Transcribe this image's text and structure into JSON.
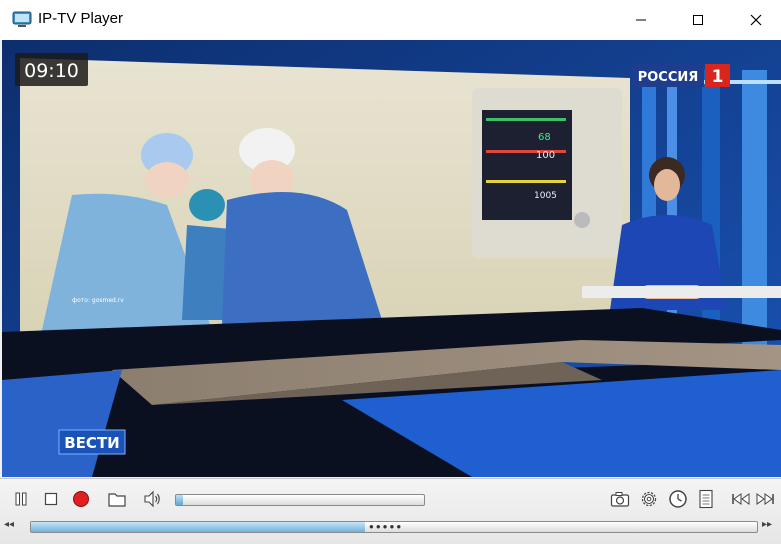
{
  "window": {
    "title": "IP-TV Player"
  },
  "overlay": {
    "clock": "09:10",
    "channel_logo": "РОССИЯ",
    "channel_number": "1",
    "show_logo": "ВЕСТИ",
    "photo_credit": "фото: gosmed.rv"
  },
  "monitor": {
    "readout_1": "68",
    "readout_2": "100",
    "readout_3": "1005"
  },
  "playback": {
    "volume_level_percent": 3,
    "seek_position_percent": 46
  },
  "colors": {
    "accent": "#5ea7d6",
    "record": "#e02020",
    "channel_red": "#d8261f",
    "studio_blue": "#1a4fb0"
  },
  "icons": {
    "pause": "pause-icon",
    "stop": "stop-icon",
    "record": "record-icon",
    "open": "folder-icon",
    "volume": "speaker-icon",
    "snapshot": "camera-icon",
    "settings": "gear-icon",
    "schedule": "clock-icon",
    "playlist": "list-icon",
    "prev": "previous-icon",
    "next": "next-icon"
  }
}
